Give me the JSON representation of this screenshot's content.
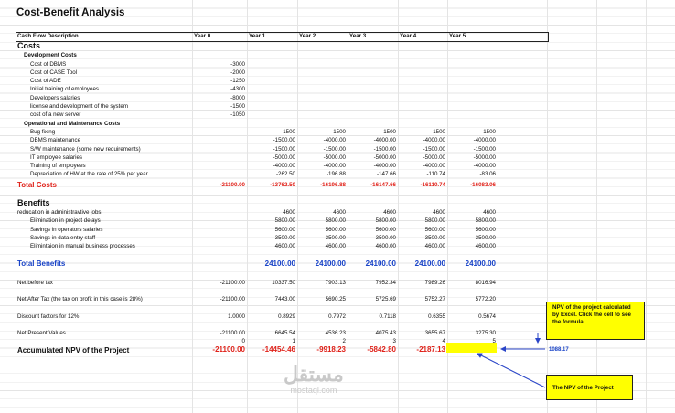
{
  "title": "Cost-Benefit Analysis",
  "header": {
    "desc": "Cash Flow Description",
    "years": [
      "Year 0",
      "Year 1",
      "Year 2",
      "Year 3",
      "Year 4",
      "Year 5"
    ]
  },
  "costs_label": "Costs",
  "dev_label": "Development Costs",
  "dev_rows": [
    {
      "label": "Cost of DBMS",
      "v": "-3000"
    },
    {
      "label": "Cost of CASE Tool",
      "v": "-2000"
    },
    {
      "label": "Cost of ADE",
      "v": "-1250"
    },
    {
      "label": "Initial training of employees",
      "v": "-4300"
    },
    {
      "label": "Developers salaries",
      "v": "-8000"
    },
    {
      "label": "license and development of the system",
      "v": "-1500"
    },
    {
      "label": "cost of a new server",
      "v": "-1050"
    }
  ],
  "om_label": "Operational and Maintenance Costs",
  "om_rows": [
    {
      "label": "Bug fixing",
      "v": [
        "-1500",
        "-1500",
        "-1500",
        "-1500",
        "-1500"
      ]
    },
    {
      "label": "DBMS maintenance",
      "v": [
        "-1500.00",
        "-4000.00",
        "-4000.00",
        "-4000.00",
        "-4000.00"
      ]
    },
    {
      "label": "S/W maintenance (some new requirements)",
      "v": [
        "-1500.00",
        "-1500.00",
        "-1500.00",
        "-1500.00",
        "-1500.00"
      ]
    },
    {
      "label": "IT employee salaries",
      "v": [
        "-5000.00",
        "-5000.00",
        "-5000.00",
        "-5000.00",
        "-5000.00"
      ]
    },
    {
      "label": "Training of employees",
      "v": [
        "-4000.00",
        "-4000.00",
        "-4000.00",
        "-4000.00",
        "-4000.00"
      ]
    },
    {
      "label": "Depreciation of HW at the rate of 25% per year",
      "v": [
        "-262.50",
        "-196.88",
        "-147.66",
        "-110.74",
        "-83.06"
      ]
    }
  ],
  "total_costs": {
    "label": "Total Costs",
    "v": [
      "-21100.00",
      "-13762.50",
      "-16196.88",
      "-16147.66",
      "-16110.74",
      "-16083.06"
    ]
  },
  "benefits_label": "Benefits",
  "benefit_rows": [
    {
      "label": "reducation in administravtive jobs",
      "v": [
        "4600",
        "4600",
        "4600",
        "4600",
        "4600"
      ]
    },
    {
      "label": "Elimination in project delays",
      "v": [
        "5800.00",
        "5800.00",
        "5800.00",
        "5800.00",
        "5800.00"
      ]
    },
    {
      "label": "Savings in operators salaries",
      "v": [
        "5600.00",
        "5600.00",
        "5600.00",
        "5600.00",
        "5600.00"
      ]
    },
    {
      "label": "Savings in data entry staff",
      "v": [
        "3500.00",
        "3500.00",
        "3500.00",
        "3500.00",
        "3500.00"
      ]
    },
    {
      "label": "Elimintaion in manual business processes",
      "v": [
        "4600.00",
        "4600.00",
        "4600.00",
        "4600.00",
        "4600.00"
      ]
    }
  ],
  "total_benefits": {
    "label": "Total Benefits",
    "v": [
      "24100.00",
      "24100.00",
      "24100.00",
      "24100.00",
      "24100.00"
    ]
  },
  "net_before_tax": {
    "label": "Net before tax",
    "v": [
      "-21100.00",
      "10337.50",
      "7903.13",
      "7952.34",
      "7989.26",
      "8016.94"
    ]
  },
  "net_after_tax": {
    "label": "Net After Tax (the tax on profit in this case is 28%)",
    "v": [
      "-21100.00",
      "7443.00",
      "5690.25",
      "5725.69",
      "5752.27",
      "5772.20"
    ]
  },
  "discount": {
    "label": "Discount factors for 12%",
    "v": [
      "1.0000",
      "0.8929",
      "0.7972",
      "0.7118",
      "0.6355",
      "0.5674"
    ]
  },
  "npv_values": {
    "label": "Net Present Values",
    "v": [
      "-21100.00",
      "6645.54",
      "4536.23",
      "4075.43",
      "3655.67",
      "3275.30"
    ]
  },
  "year_index": [
    "0",
    "1",
    "2",
    "3",
    "4",
    "5"
  ],
  "accumulated": {
    "label": "Accumulated NPV of the Project",
    "v": [
      "-21100.00",
      "-14454.46",
      "-9918.23",
      "-5842.80",
      "-2187.13",
      "1088.17"
    ]
  },
  "side_value": "1088.17",
  "note_excel": "NPV of the project calculated by Excel. Click the cell to see the formula.",
  "note_npv": "The NPV of the Project",
  "watermark_ar": "مستقل",
  "watermark_en": "mostaql.com",
  "colors": {
    "red": "#e0221a",
    "blue": "#1a44c8",
    "highlight": "#ffff00"
  }
}
